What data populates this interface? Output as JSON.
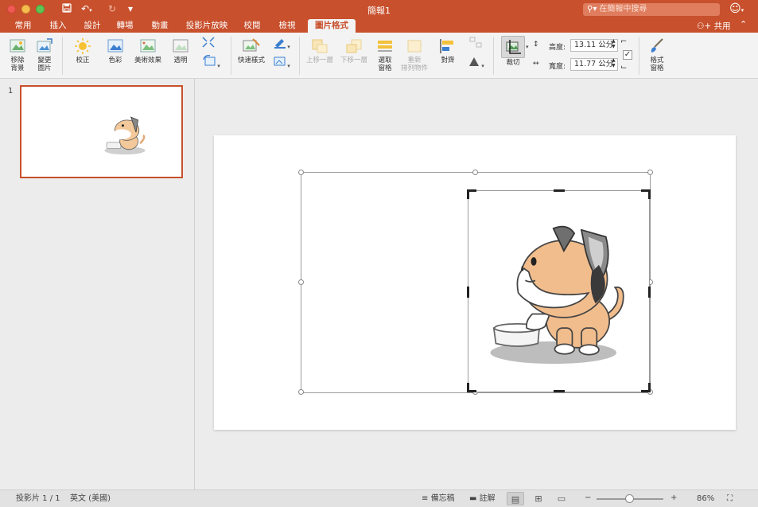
{
  "window": {
    "title": "簡報1",
    "search_placeholder": "在簡報中搜尋",
    "share_label": "共用"
  },
  "tabs": [
    {
      "label": "常用"
    },
    {
      "label": "插入"
    },
    {
      "label": "設計"
    },
    {
      "label": "轉場"
    },
    {
      "label": "動畫"
    },
    {
      "label": "投影片放映"
    },
    {
      "label": "校閱"
    },
    {
      "label": "檢視"
    },
    {
      "label": "圖片格式",
      "active": true
    }
  ],
  "ribbon": {
    "remove_bg": "移除\n背景",
    "change_pic": "變更\n圖片",
    "corrections": "校正",
    "color": "色彩",
    "artistic": "美術效果",
    "transparency": "透明",
    "quick_styles": "快速樣式",
    "bring_forward": "上移一層",
    "send_backward": "下移一層",
    "selection_pane": "選取\n窗格",
    "reorder": "重新\n排列物件",
    "align": "對齊",
    "crop": "裁切",
    "height_label": "高度:",
    "height_value": "13.11 公分",
    "width_label": "寬度:",
    "width_value": "11.77 公分",
    "format_pane": "格式\n窗格"
  },
  "thumbnails": [
    {
      "number": "1"
    }
  ],
  "statusbar": {
    "slide_info": "投影片 1 / 1",
    "language": "英文 (美國)",
    "notes": "備忘稿",
    "comments": "註解",
    "zoom": "86%"
  },
  "colors": {
    "accent": "#c8502c",
    "ribbon_bg": "#f3f3f3",
    "workspace_bg": "#ececec"
  },
  "icons": {
    "crop": "crop-icon",
    "search": "search-icon",
    "add_person": "add-person-icon"
  }
}
